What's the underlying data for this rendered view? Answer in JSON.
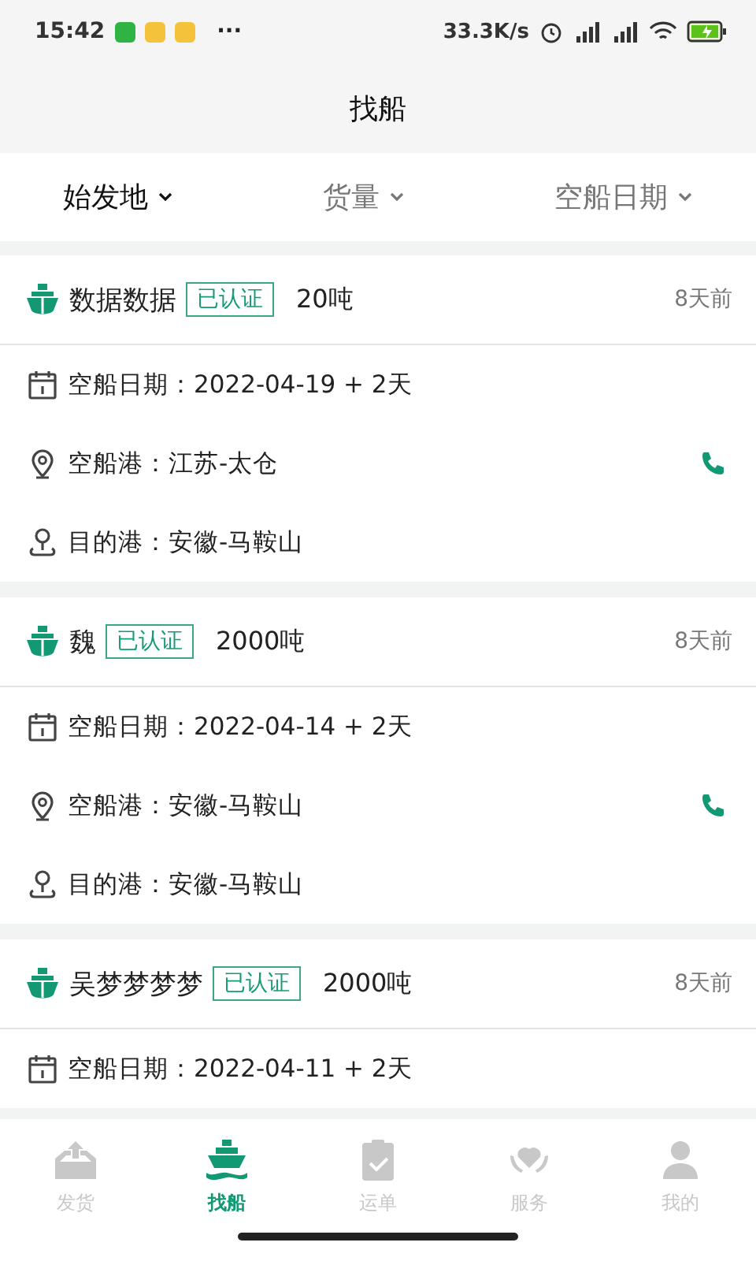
{
  "status_bar": {
    "time": "15:42",
    "more": "···",
    "speed": "33.3K/s"
  },
  "header": {
    "title": "找船"
  },
  "filters": [
    {
      "label": "始发地",
      "selected": true
    },
    {
      "label": "货量",
      "selected": false
    },
    {
      "label": "空船日期",
      "selected": false
    }
  ],
  "ships": [
    {
      "name": "数据数据",
      "badge": "已认证",
      "tonnage": "20吨",
      "age": "8天前",
      "date": "空船日期：2022-04-19 + 2天",
      "origin": "空船港：江苏-太仓",
      "destination": "目的港：安徽-马鞍山"
    },
    {
      "name": "魏",
      "badge": "已认证",
      "tonnage": "2000吨",
      "age": "8天前",
      "date": "空船日期：2022-04-14 + 2天",
      "origin": "空船港：安徽-马鞍山",
      "destination": "目的港：安徽-马鞍山"
    },
    {
      "name": "吴梦梦梦梦",
      "badge": "已认证",
      "tonnage": "2000吨",
      "age": "8天前",
      "date": "空船日期：2022-04-11 + 2天"
    }
  ],
  "nav": [
    {
      "label": "发货",
      "selected": false,
      "kind": "ship-out"
    },
    {
      "label": "找船",
      "selected": true,
      "kind": "boat"
    },
    {
      "label": "运单",
      "selected": false,
      "kind": "clipboard"
    },
    {
      "label": "服务",
      "selected": false,
      "kind": "heart"
    },
    {
      "label": "我的",
      "selected": false,
      "kind": "person"
    }
  ]
}
